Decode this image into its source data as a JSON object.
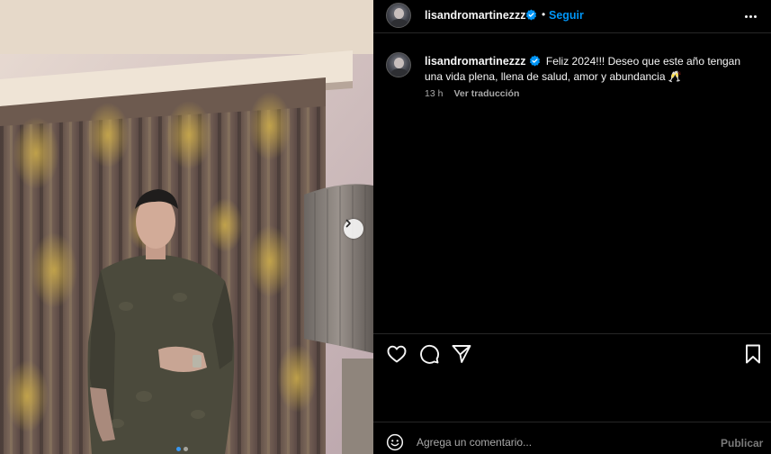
{
  "post": {
    "username": "lisandromartinezzz",
    "verified": true,
    "follow_label": "Seguir",
    "separator": "•",
    "caption": "Feliz 2024!!! Deseo que este año tengan una vida plena, llena de salud, amor y abundancia 🥂",
    "time_ago": "13 h",
    "translate_label": "Ver traducción"
  },
  "comment": {
    "placeholder": "Agrega un comentario...",
    "publish_label": "Publicar"
  },
  "carousel": {
    "dot_count": 2,
    "active_index": 0
  },
  "icons": {
    "like": "heart-icon",
    "comment": "comment-bubble-icon",
    "share": "paper-plane-icon",
    "save": "bookmark-icon",
    "emoji": "smiley-icon",
    "more": "more-horizontal-icon",
    "next": "chevron-right-icon"
  },
  "colors": {
    "accent": "#0095f6",
    "verified": "#0095f6",
    "background": "#000000",
    "muted_text": "#a8a8a8"
  }
}
